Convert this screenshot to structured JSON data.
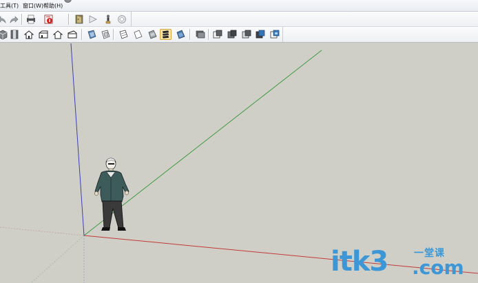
{
  "menu": {
    "tools": "工具(T)",
    "window": "窗口(W)",
    "help": "帮助(H)"
  },
  "toolbar_top": {
    "icons": [
      "undo-icon",
      "redo-icon",
      "print-icon",
      "model-info-icon",
      "walk-icon",
      "look-around-icon",
      "position-camera-icon",
      "zoom-window-icon"
    ]
  },
  "toolbar_views": {
    "icons": [
      "iso-view-icon",
      "top-view-icon",
      "front-view-icon",
      "right-view-icon",
      "back-view-icon",
      "left-view-icon",
      "xray-style-icon",
      "wireframe-style-icon",
      "hidden-line-style-icon",
      "shaded-style-icon",
      "shaded-textures-style-icon",
      "monochrome-style-icon",
      "outliner-icon",
      "layers-icon",
      "components-icon",
      "materials-icon",
      "styles-icon",
      "scenes-icon"
    ],
    "active_style": "shaded-textures-style-icon"
  },
  "watermark": {
    "main": "itk3",
    "cn": "一堂课",
    "com": ".com"
  },
  "colors": {
    "canvas": "#cfcfc8",
    "red_axis": "#c23a36",
    "green_axis": "#3f9a3f",
    "blue_axis": "#3b3fb3",
    "watermark": "#3d97d6",
    "figure_jacket": "#3d5b5a",
    "figure_pants": "#3a3a3a"
  }
}
